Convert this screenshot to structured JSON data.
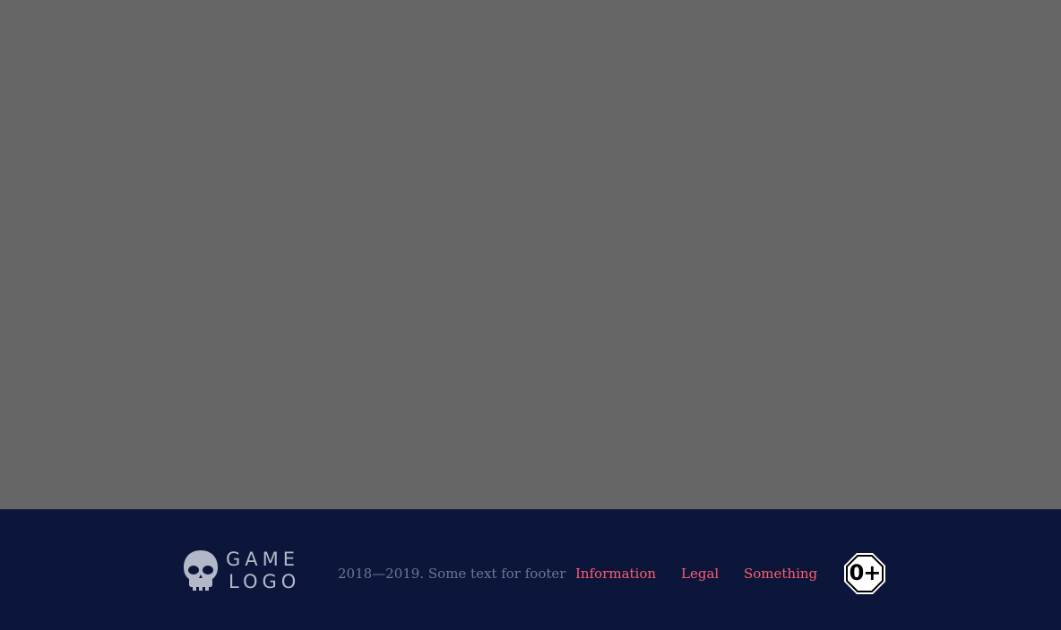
{
  "footer": {
    "logo": {
      "line1": "GAME",
      "line2": "LOGO",
      "icon": "skull-icon",
      "color": "#b3b8c9"
    },
    "copyright": "2018—2019. Some text for footer",
    "links": [
      {
        "label": "Information"
      },
      {
        "label": "Legal"
      },
      {
        "label": "Something"
      }
    ],
    "rating": {
      "label": "0+",
      "icon": "age-rating-icon"
    },
    "background_color": "#0c163b",
    "link_color": "#ff5c6e",
    "text_color": "#6e7696"
  },
  "main": {
    "background_color": "#666666"
  }
}
